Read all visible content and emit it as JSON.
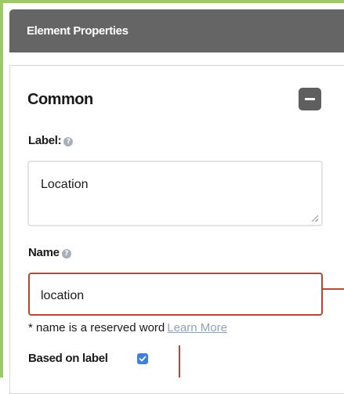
{
  "header": {
    "title": "Element Properties"
  },
  "section": {
    "title": "Common",
    "collapse_icon": "minus-icon"
  },
  "label_field": {
    "label": "Label:",
    "help_icon": "question-icon",
    "value": "Location"
  },
  "name_field": {
    "label": "Name",
    "help_icon": "question-icon",
    "value": "location",
    "reserved_note": "* name is a reserved word",
    "learn_more": "Learn More"
  },
  "based_on_label": {
    "label": "Based on label",
    "checked": true
  },
  "colors": {
    "frame_accent": "#9dc96a",
    "header_bg": "#656565",
    "error_border": "#b9443a",
    "link": "#8ea3b8",
    "checkbox": "#3f7fe0"
  }
}
